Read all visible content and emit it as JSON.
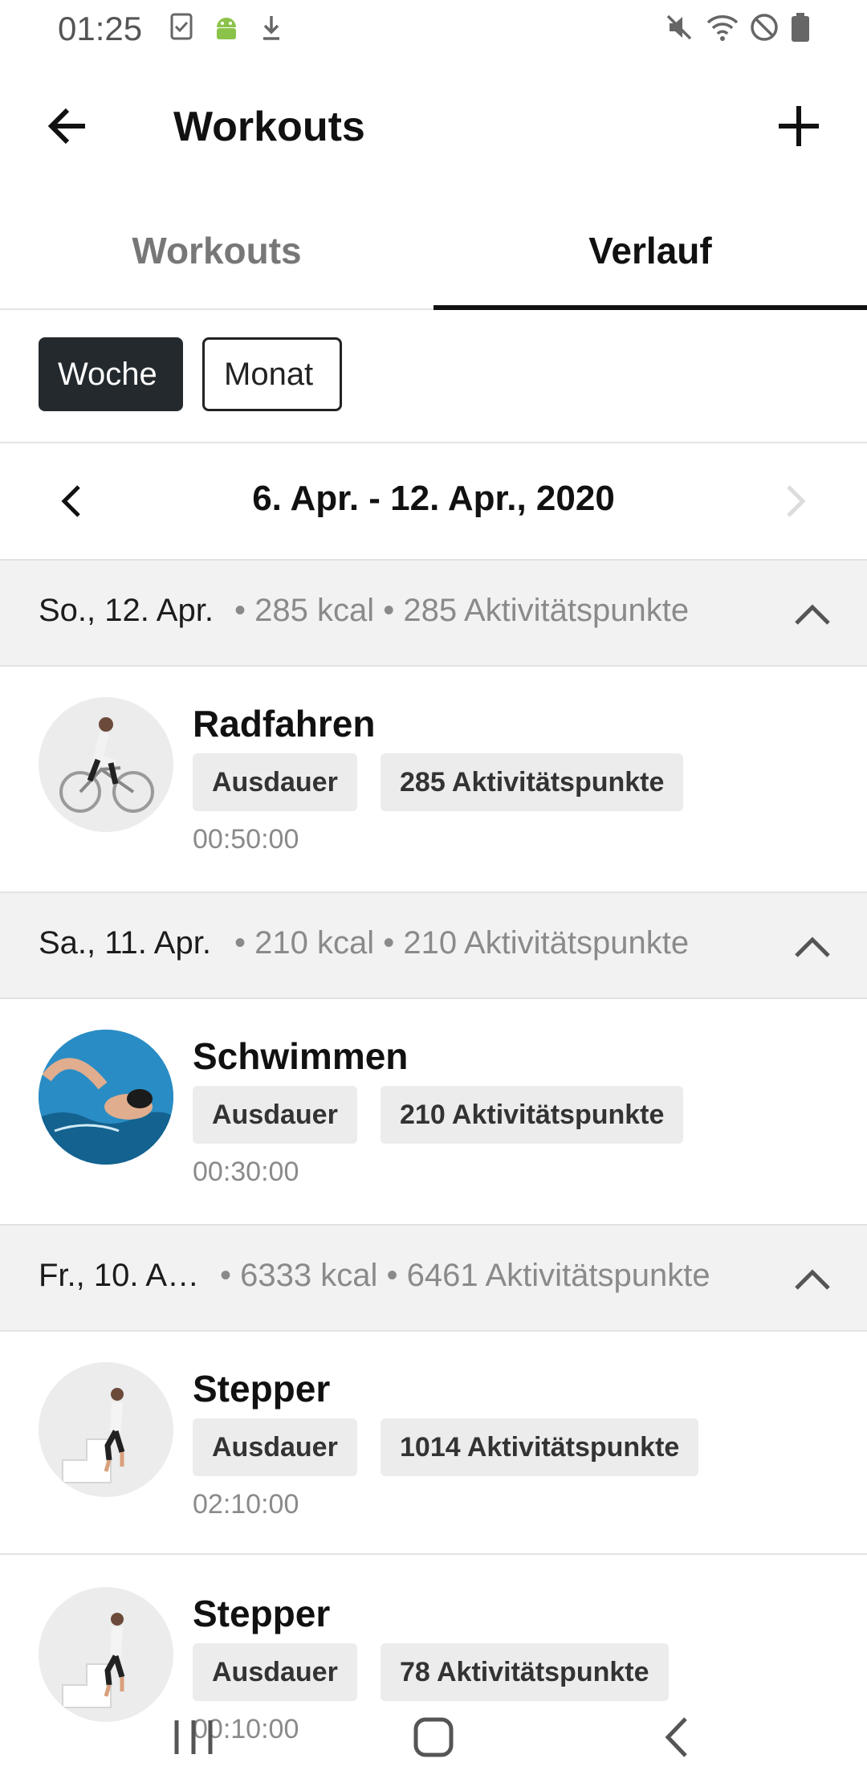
{
  "status_bar": {
    "time": "01:25",
    "left_icons": [
      "task-check-icon",
      "android-icon",
      "download-icon"
    ],
    "right_icons": [
      "mute-icon",
      "wifi-icon",
      "do-not-disturb-icon",
      "battery-icon"
    ]
  },
  "app_bar": {
    "title": "Workouts",
    "back_icon": "arrow-back-icon",
    "add_icon": "plus-icon"
  },
  "tabs": [
    {
      "label": "Workouts",
      "selected": false
    },
    {
      "label": "Verlauf",
      "selected": true
    }
  ],
  "period_filter": {
    "options": [
      {
        "label": "Woche",
        "selected": true
      },
      {
        "label": "Monat",
        "selected": false
      }
    ]
  },
  "date_range": {
    "label": "6. Apr. - 12. Apr., 2020",
    "next_enabled": false
  },
  "days": [
    {
      "date": "So., 12. Apr.",
      "stats": "• 285 kcal • 285 Aktivitätspunkte",
      "workouts": [
        {
          "name": "Radfahren",
          "category": "Ausdauer",
          "points": "285 Aktivitätspunkte",
          "duration": "00:50:00",
          "image": "cycling-icon"
        }
      ]
    },
    {
      "date": "Sa., 11. Apr.",
      "stats": "• 210 kcal • 210 Aktivitätspunkte",
      "workouts": [
        {
          "name": "Schwimmen",
          "category": "Ausdauer",
          "points": "210 Aktivitätspunkte",
          "duration": "00:30:00",
          "image": "swimming-icon"
        }
      ]
    },
    {
      "date": "Fr., 10. A…",
      "stats": "• 6333 kcal • 6461 Aktivitätspunkte",
      "workouts": [
        {
          "name": "Stepper",
          "category": "Ausdauer",
          "points": "1014 Aktivitätspunkte",
          "duration": "02:10:00",
          "image": "stepper-icon"
        },
        {
          "name": "Stepper",
          "category": "Ausdauer",
          "points": "78 Aktivitätspunkte",
          "duration": "00:10:00",
          "image": "stepper-icon"
        }
      ]
    }
  ],
  "nav_bar": {
    "icons": [
      "recents-icon",
      "home-icon",
      "back-icon"
    ]
  },
  "colors": {
    "accent": "#111111",
    "chip_selected_bg": "#24292d",
    "section_bg": "#f2f2f2",
    "tag_bg": "#ececec",
    "muted_text": "#8a8a8a"
  }
}
